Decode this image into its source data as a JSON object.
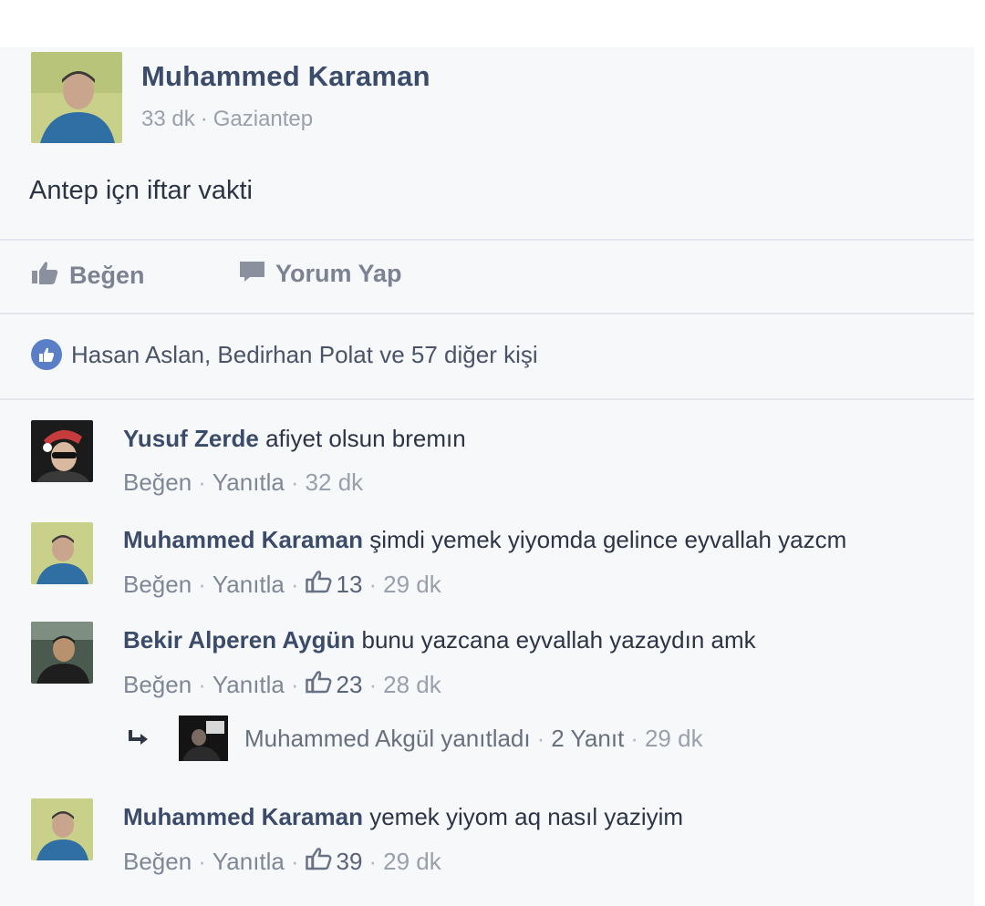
{
  "post": {
    "author": "Muhammed Karaman",
    "time": "33 dk",
    "location": "Gaziantep",
    "text": "Antep içn iftar vakti",
    "actions": {
      "like": "Beğen",
      "comment": "Yorum Yap"
    },
    "likes_summary": "Hasan Aslan, Bedirhan Polat ve 57 diğer kişi"
  },
  "comments": [
    {
      "name": "Yusuf Zerde",
      "text": "afiyet olsun bremın",
      "like": "Beğen",
      "reply": "Yanıtla",
      "likes": "",
      "time": "32 dk"
    },
    {
      "name": "Muhammed Karaman",
      "text": "şimdi yemek yiyomda gelince eyvallah yazcm",
      "like": "Beğen",
      "reply": "Yanıtla",
      "likes": "13",
      "time": "29 dk"
    },
    {
      "name": "Bekir Alperen Aygün",
      "text": "bunu yazcana eyvallah yazaydın amk",
      "like": "Beğen",
      "reply": "Yanıtla",
      "likes": "23",
      "time": "28 dk"
    },
    {
      "name": "Muhammed Karaman",
      "text": "yemek yiyom aq nasıl yaziyim",
      "like": "Beğen",
      "reply": "Yanıtla",
      "likes": "39",
      "time": "29 dk"
    }
  ],
  "reply_thread": {
    "text": "Muhammed Akgül yanıtladı",
    "count": "2 Yanıt",
    "time": "29 dk"
  },
  "icons": [
    "thumbs-up-icon",
    "comment-icon",
    "like-circle-icon",
    "reply-arrow-icon"
  ]
}
